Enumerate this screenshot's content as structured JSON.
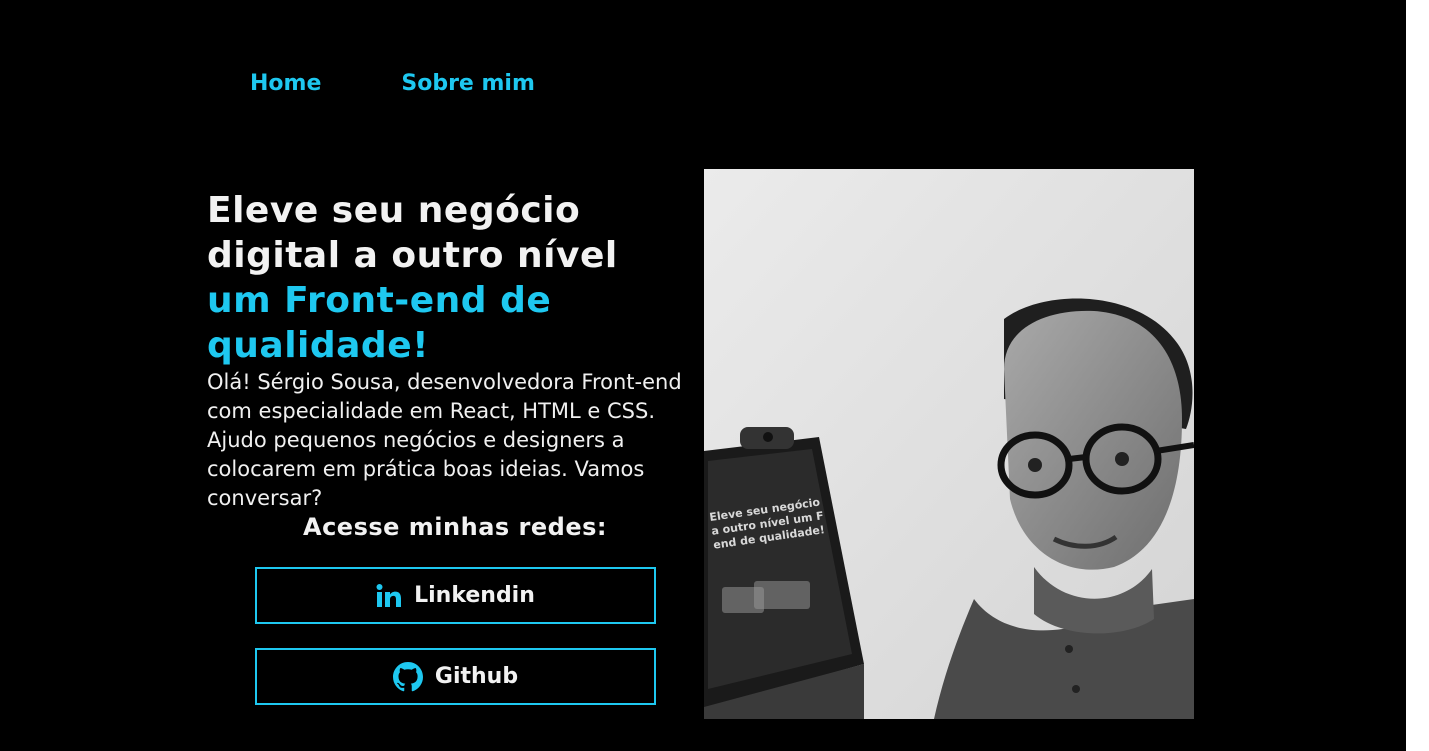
{
  "nav": {
    "items": [
      {
        "label": "Home"
      },
      {
        "label": "Sobre mim"
      }
    ]
  },
  "hero": {
    "title_line1": "Eleve seu negócio",
    "title_line2": "digital a outro nível",
    "title_accent_line1": "um Front-end de",
    "title_accent_line2": "qualidade!",
    "intro": "Olá! Sérgio Sousa, desenvolvedora Front-end com especialidade em React, HTML e CSS. Ajudo pequenos negócios e designers a colocarem em prática boas ideias. Vamos conversar?"
  },
  "social": {
    "heading": "Acesse minhas redes:",
    "linkedin_label": "Linkendin",
    "github_label": "Github",
    "linkedin_icon": "linkedin-icon",
    "github_icon": "github-icon"
  },
  "photo": {
    "screen_text_line1": "Eleve seu negócio",
    "screen_text_line2": "a outro nível um F",
    "screen_text_line3": "end de qualidade!"
  },
  "colors": {
    "accent": "#1ec8f0",
    "background": "#000000",
    "text": "#f2f2f2"
  }
}
